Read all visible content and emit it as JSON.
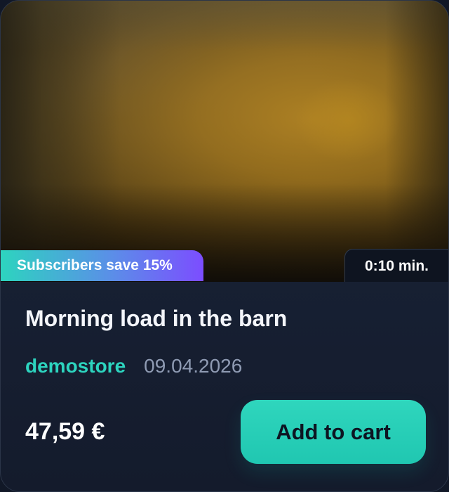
{
  "promo": {
    "label": "Subscribers save 15%"
  },
  "media": {
    "duration": "0:10 min."
  },
  "product": {
    "title": "Morning load in the barn",
    "store": "demostore",
    "date": "09.04.2026",
    "price": "47,59 €",
    "cta": "Add to cart"
  },
  "colors": {
    "accent": "#2dd4bf",
    "promo_start": "#2dd4bf",
    "promo_end": "#7c4dff",
    "card_background": "#172033",
    "duration_background": "#0e1420",
    "text_primary": "#f4f6fb",
    "text_secondary": "#8f9bb3"
  }
}
